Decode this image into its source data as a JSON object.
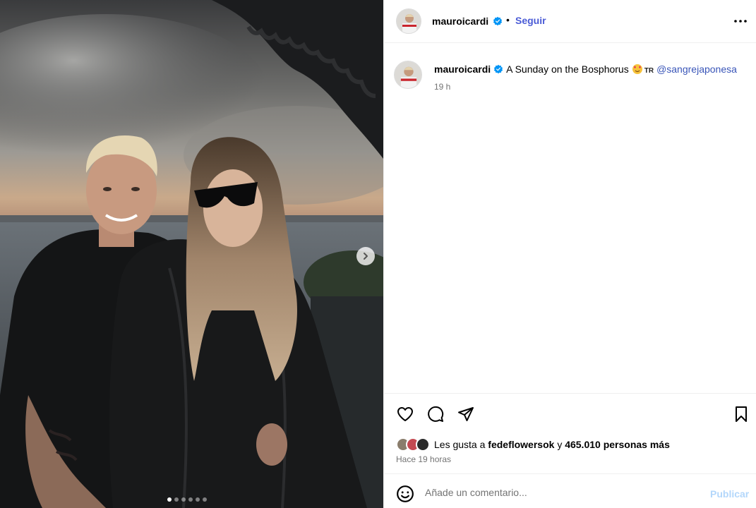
{
  "post": {
    "username": "mauroicardi",
    "follow_label": "Seguir",
    "separator": "•",
    "caption_text": "A Sunday on the Bosphorus",
    "caption_flag": "TR",
    "mention": "@sangrejaponesa",
    "time": "19 h"
  },
  "likes": {
    "prefix": "Les gusta a",
    "user": "fedeflowersok",
    "connector": "y",
    "count": "465.010 personas más",
    "ago": "Hace 19 horas"
  },
  "comment": {
    "placeholder": "Añade un comentario...",
    "publish_label": "Publicar"
  },
  "carousel": {
    "total": 6,
    "active_index": 0
  },
  "colors": {
    "accent": "#4a5bd6",
    "mention": "#3955b8",
    "publish_disabled": "#b3d7fb",
    "muted": "#737373",
    "verified": "#0095f6"
  },
  "icons": [
    "more-icon",
    "verified-icon",
    "heart-icon",
    "comment-icon",
    "share-icon",
    "bookmark-icon",
    "smile-icon",
    "chevron-right-icon"
  ]
}
